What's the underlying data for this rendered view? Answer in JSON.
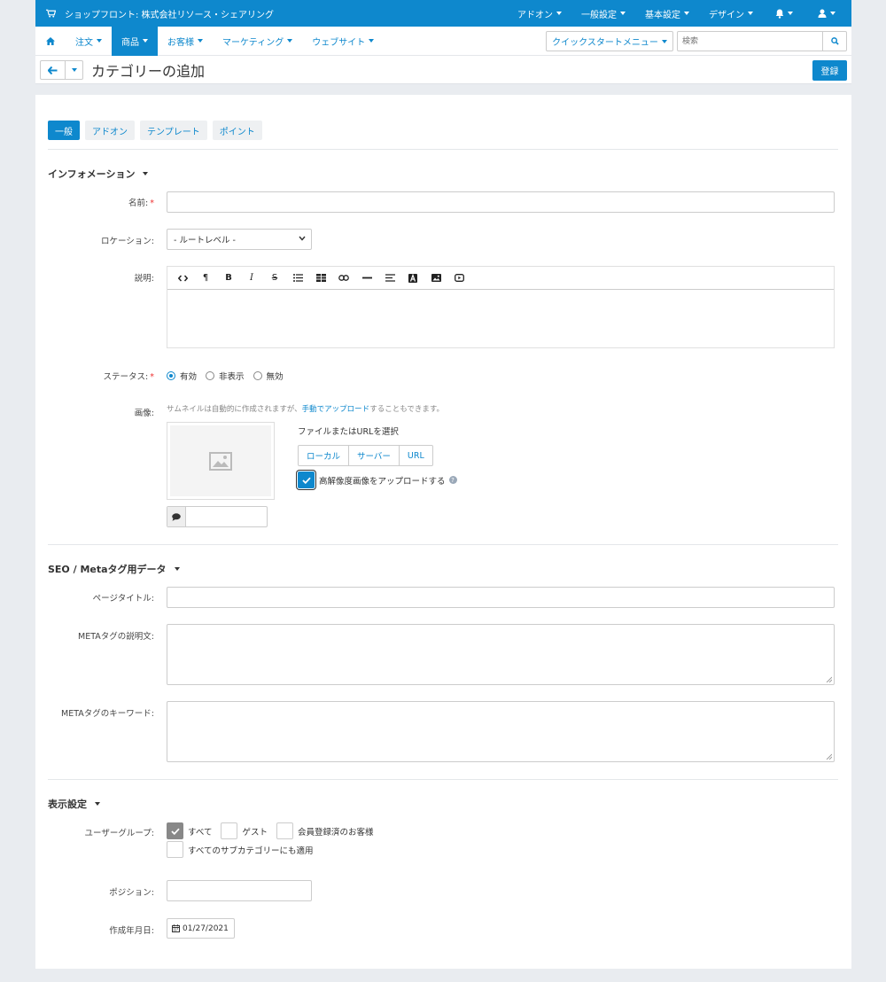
{
  "topbar": {
    "store_title": "ショップフロント: 株式会社リソース・シェアリング",
    "menu": [
      "アドオン",
      "一般設定",
      "基本設定",
      "デザイン"
    ]
  },
  "nav": {
    "items": [
      "注文",
      "商品",
      "お客様",
      "マーケティング",
      "ウェブサイト"
    ],
    "active": "商品",
    "quickstart": "クイックスタートメニュー",
    "search_placeholder": "検索"
  },
  "titlebar": {
    "title": "カテゴリーの追加",
    "save_label": "登録"
  },
  "tabs": [
    "一般",
    "アドオン",
    "テンプレート",
    "ポイント"
  ],
  "info": {
    "heading": "インフォメーション",
    "name_label": "名前:",
    "location_label": "ロケーション:",
    "location_value": "- ルートレベル -",
    "description_label": "説明:",
    "status_label": "ステータス:",
    "status_options": [
      "有効",
      "非表示",
      "無効"
    ],
    "image_label": "画像:",
    "image_note_before": "サムネイルは自動的に作成されますが、",
    "image_note_link": "手動でアップロード",
    "image_note_after": "することもできます。",
    "file_select_label": "ファイルまたはURLを選択",
    "file_buttons": [
      "ローカル",
      "サーバー",
      "URL"
    ],
    "hires_label": "高解像度画像をアップロードする"
  },
  "seo": {
    "heading": "SEO / Metaタグ用データ",
    "page_title_label": "ページタイトル:",
    "meta_desc_label": "METAタグの説明文:",
    "meta_keywords_label": "METAタグのキーワード:"
  },
  "display": {
    "heading": "表示設定",
    "usergroup_label": "ユーザーグループ:",
    "usergroups": [
      "すべて",
      "ゲスト",
      "会員登録済のお客様"
    ],
    "apply_sub_label": "すべてのサブカテゴリーにも適用",
    "position_label": "ポジション:",
    "created_label": "作成年月日:",
    "created_value": "01/27/2021"
  },
  "colors": {
    "primary": "#0e88cd",
    "background": "#e9ecf0"
  }
}
